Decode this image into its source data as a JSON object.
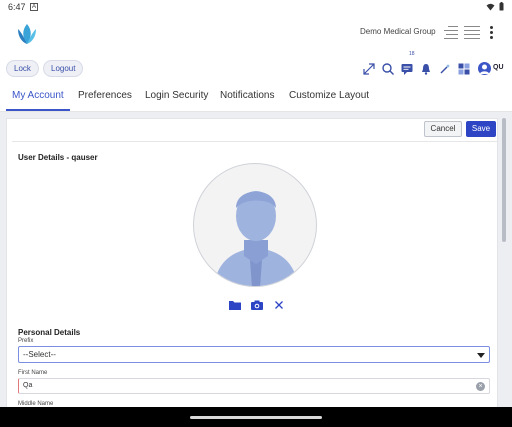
{
  "status": {
    "time": "6:47",
    "notif": "A"
  },
  "header": {
    "org": "Demo Medical Group"
  },
  "toolbar": {
    "lock": "Lock",
    "logout": "Logout",
    "user": "QU",
    "badge": "18"
  },
  "tabs": [
    "My Account",
    "Preferences",
    "Login Security",
    "Notifications",
    "Customize Layout"
  ],
  "actions": {
    "cancel": "Cancel",
    "save": "Save"
  },
  "user_details": {
    "title": "User Details - qauser"
  },
  "personal": {
    "title": "Personal Details",
    "prefix_label": "Prefix",
    "prefix_value": "--Select--",
    "first_name_label": "First Name",
    "first_name_value": "Qa",
    "middle_name_label": "Middle Name"
  },
  "colors": {
    "accent": "#2d45c4",
    "tab_active": "#3a55c8"
  }
}
